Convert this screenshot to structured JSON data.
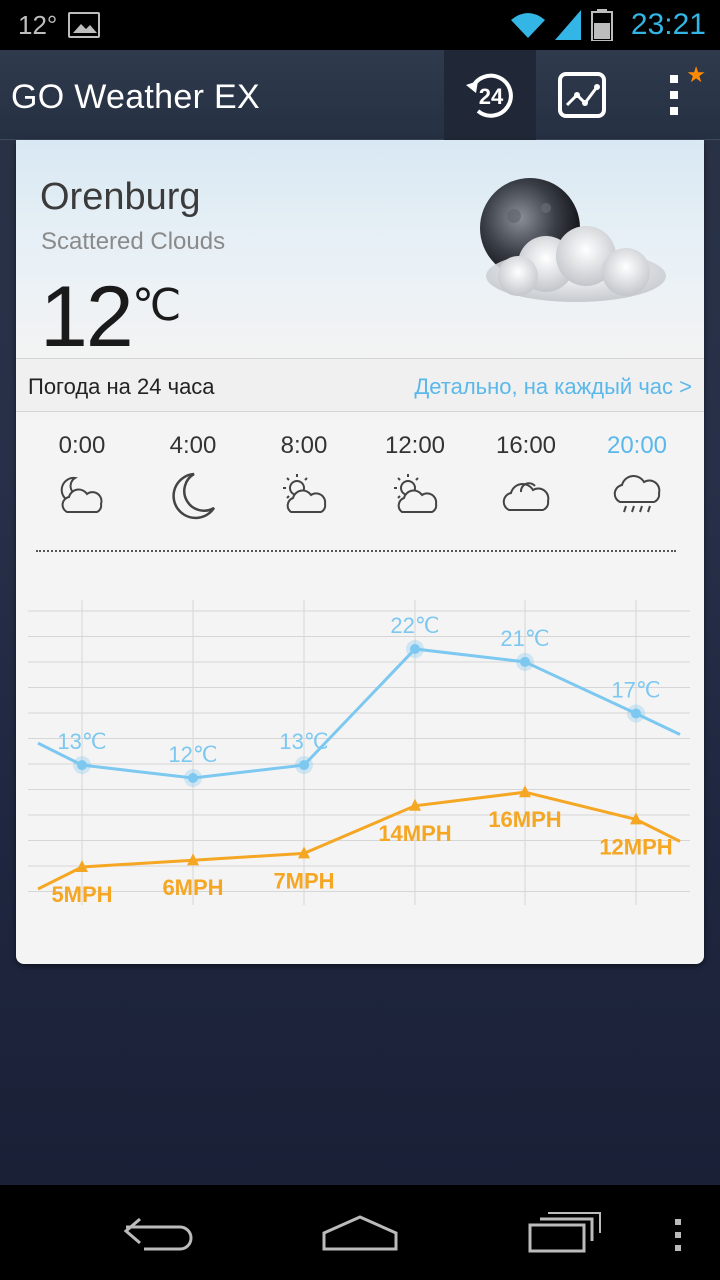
{
  "status_bar": {
    "temperature": "12°",
    "time": "23:21"
  },
  "app": {
    "title": "GO Weather EX",
    "hour24_label": "24"
  },
  "current": {
    "city": "Orenburg",
    "condition": "Scattered Clouds",
    "temperature": "12",
    "unit": "℃"
  },
  "forecast_bar": {
    "title": "Погода на 24 часа",
    "link": "Детально, на каждый час >"
  },
  "hours": [
    {
      "time": "0:00",
      "icon": "night-cloud-icon"
    },
    {
      "time": "4:00",
      "icon": "moon-icon"
    },
    {
      "time": "8:00",
      "icon": "sun-cloud-icon"
    },
    {
      "time": "12:00",
      "icon": "sun-cloud-icon"
    },
    {
      "time": "16:00",
      "icon": "cloud-icon"
    },
    {
      "time": "20:00",
      "icon": "rain-cloud-icon"
    }
  ],
  "chart_data": {
    "type": "line",
    "categories": [
      "0:00",
      "4:00",
      "8:00",
      "12:00",
      "16:00",
      "20:00"
    ],
    "series": [
      {
        "values": [
          13,
          12,
          13,
          22,
          21,
          17
        ],
        "labels": [
          "13℃",
          "12℃",
          "13℃",
          "22℃",
          "21℃",
          "17℃"
        ],
        "color": "#7cc8f0"
      },
      {
        "values": [
          5,
          6,
          7,
          14,
          16,
          12
        ],
        "labels": [
          "5MPH",
          "6MPH",
          "7MPH",
          "14MPH",
          "16MPH",
          "12MPH"
        ],
        "color": "#f5a623"
      }
    ],
    "grid": true
  },
  "colors": {
    "accent": "#33b5e5",
    "temp_line": "#7cc8f0",
    "wind_line": "#f5a623",
    "star": "#ff8a00"
  }
}
